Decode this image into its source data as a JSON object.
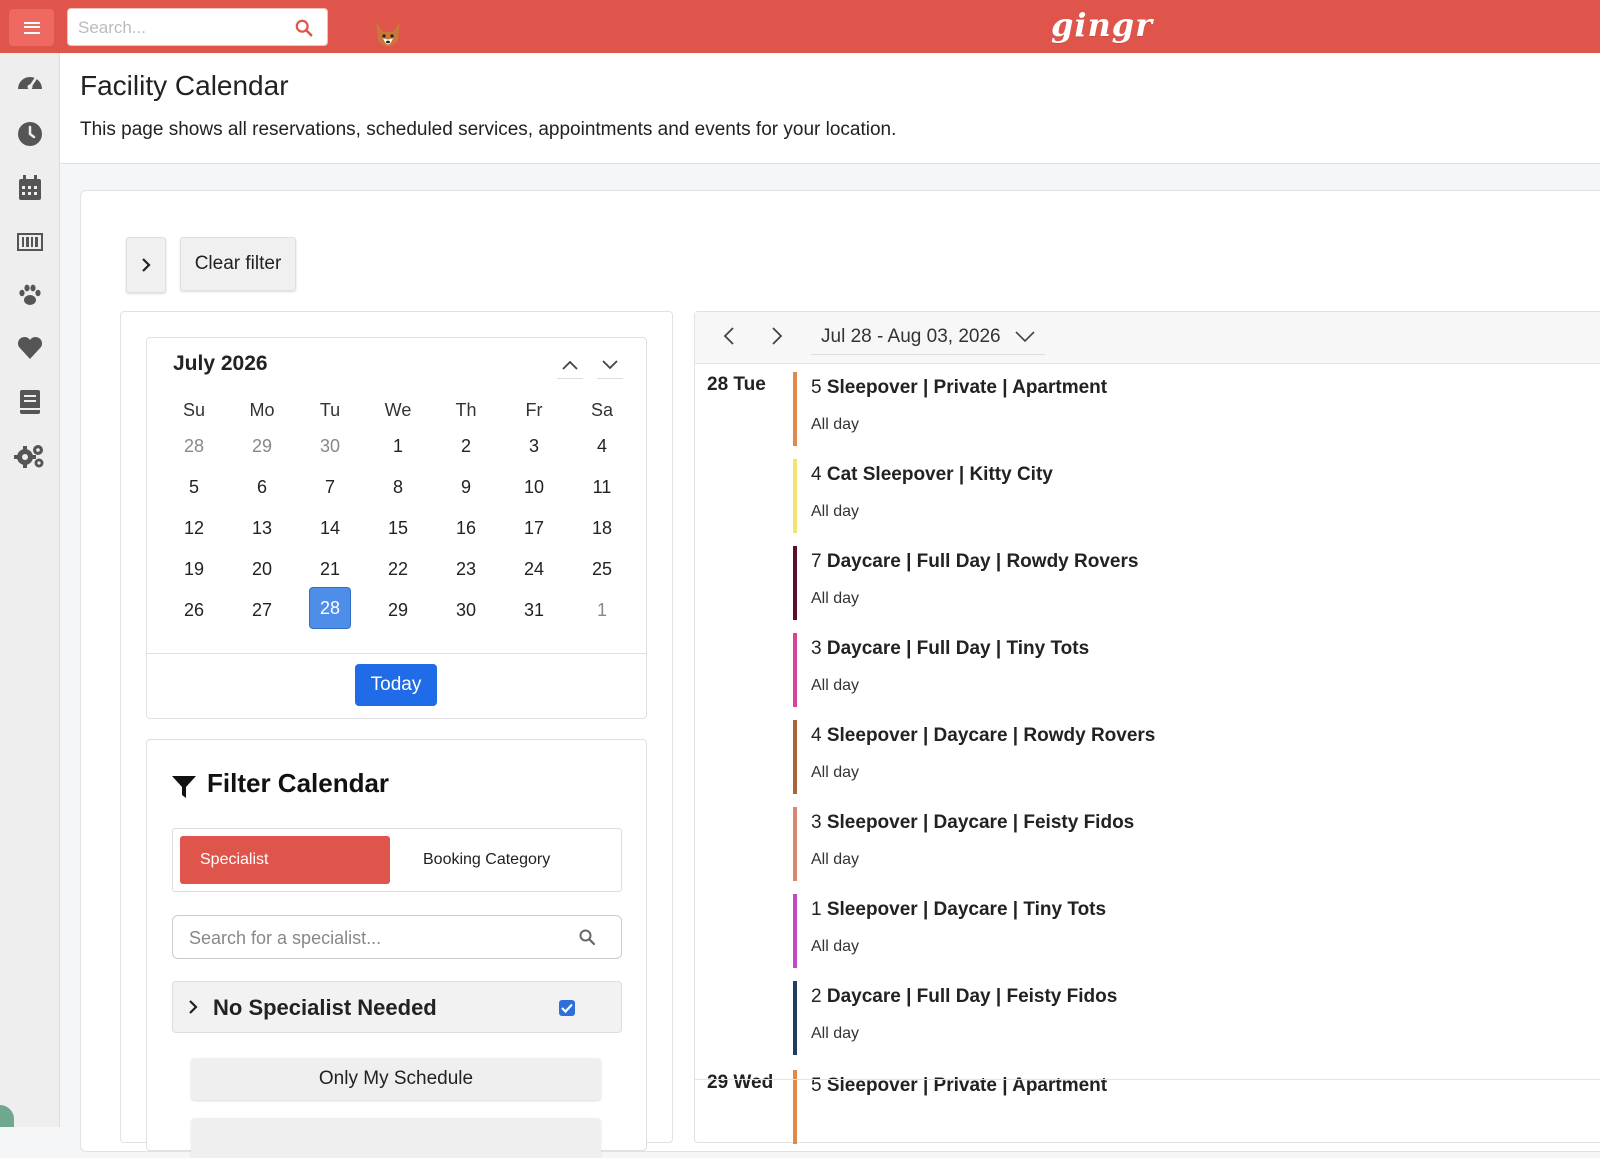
{
  "topbar": {
    "search_placeholder": "Search...",
    "logo_text": "gingr",
    "brand_color": "#e0554b"
  },
  "sidebar": {
    "items": [
      {
        "icon": "dashboard-icon"
      },
      {
        "icon": "clock-icon"
      },
      {
        "icon": "calendar-icon"
      },
      {
        "icon": "barcode-icon"
      },
      {
        "icon": "paw-icon"
      },
      {
        "icon": "heart-icon"
      },
      {
        "icon": "book-icon"
      },
      {
        "icon": "gears-icon"
      }
    ]
  },
  "header": {
    "title": "Facility Calendar",
    "subtitle": "This page shows all reservations, scheduled services, appointments and events for your location."
  },
  "toolbar": {
    "clear_filter_label": "Clear filter"
  },
  "minical": {
    "title": "July 2026",
    "dows": [
      "Su",
      "Mo",
      "Tu",
      "We",
      "Th",
      "Fr",
      "Sa"
    ],
    "weeks": [
      [
        {
          "d": "28",
          "m": true
        },
        {
          "d": "29",
          "m": true
        },
        {
          "d": "30",
          "m": true
        },
        {
          "d": "1"
        },
        {
          "d": "2"
        },
        {
          "d": "3"
        },
        {
          "d": "4"
        }
      ],
      [
        {
          "d": "5"
        },
        {
          "d": "6"
        },
        {
          "d": "7"
        },
        {
          "d": "8"
        },
        {
          "d": "9"
        },
        {
          "d": "10"
        },
        {
          "d": "11"
        }
      ],
      [
        {
          "d": "12"
        },
        {
          "d": "13"
        },
        {
          "d": "14"
        },
        {
          "d": "15"
        },
        {
          "d": "16"
        },
        {
          "d": "17"
        },
        {
          "d": "18"
        }
      ],
      [
        {
          "d": "19"
        },
        {
          "d": "20"
        },
        {
          "d": "21"
        },
        {
          "d": "22"
        },
        {
          "d": "23"
        },
        {
          "d": "24"
        },
        {
          "d": "25"
        }
      ],
      [
        {
          "d": "26"
        },
        {
          "d": "27"
        },
        {
          "d": "28",
          "sel": true
        },
        {
          "d": "29"
        },
        {
          "d": "30"
        },
        {
          "d": "31"
        },
        {
          "d": "1",
          "m": true
        }
      ]
    ],
    "today_label": "Today",
    "selected_color": "#4f8ee8"
  },
  "filter": {
    "title": "Filter Calendar",
    "tab_specialist": "Specialist",
    "tab_booking": "Booking Category",
    "search_placeholder": "Search for a specialist...",
    "no_specialist_label": "No Specialist Needed",
    "no_specialist_checked": true,
    "only_my_schedule_label": "Only My Schedule"
  },
  "agenda": {
    "range_label": "Jul 28 - Aug 03, 2026",
    "days": [
      {
        "label": "28 Tue",
        "events": [
          {
            "count": "5",
            "name": "Sleepover | Private | Apartment",
            "time": "All day",
            "color": "#e08a4a"
          },
          {
            "count": "4",
            "name": "Cat Sleepover | Kitty City",
            "time": "All day",
            "color": "#f2e46e"
          },
          {
            "count": "7",
            "name": "Daycare | Full Day | Rowdy Rovers",
            "time": "All day",
            "color": "#5a0f2e"
          },
          {
            "count": "3",
            "name": "Daycare | Full Day | Tiny Tots",
            "time": "All day",
            "color": "#d9449a"
          },
          {
            "count": "4",
            "name": "Sleepover | Daycare | Rowdy Rovers",
            "time": "All day",
            "color": "#a8643c"
          },
          {
            "count": "3",
            "name": "Sleepover | Daycare | Feisty Fidos",
            "time": "All day",
            "color": "#d88870"
          },
          {
            "count": "1",
            "name": "Sleepover | Daycare | Tiny Tots",
            "time": "All day",
            "color": "#c348c8"
          },
          {
            "count": "2",
            "name": "Daycare | Full Day | Feisty Fidos",
            "time": "All day",
            "color": "#1e3e63"
          }
        ]
      },
      {
        "label": "29 Wed",
        "events": [
          {
            "count": "5",
            "name": "Sleepover | Private | Apartment",
            "time": "",
            "color": "#e08a4a"
          }
        ]
      }
    ]
  }
}
